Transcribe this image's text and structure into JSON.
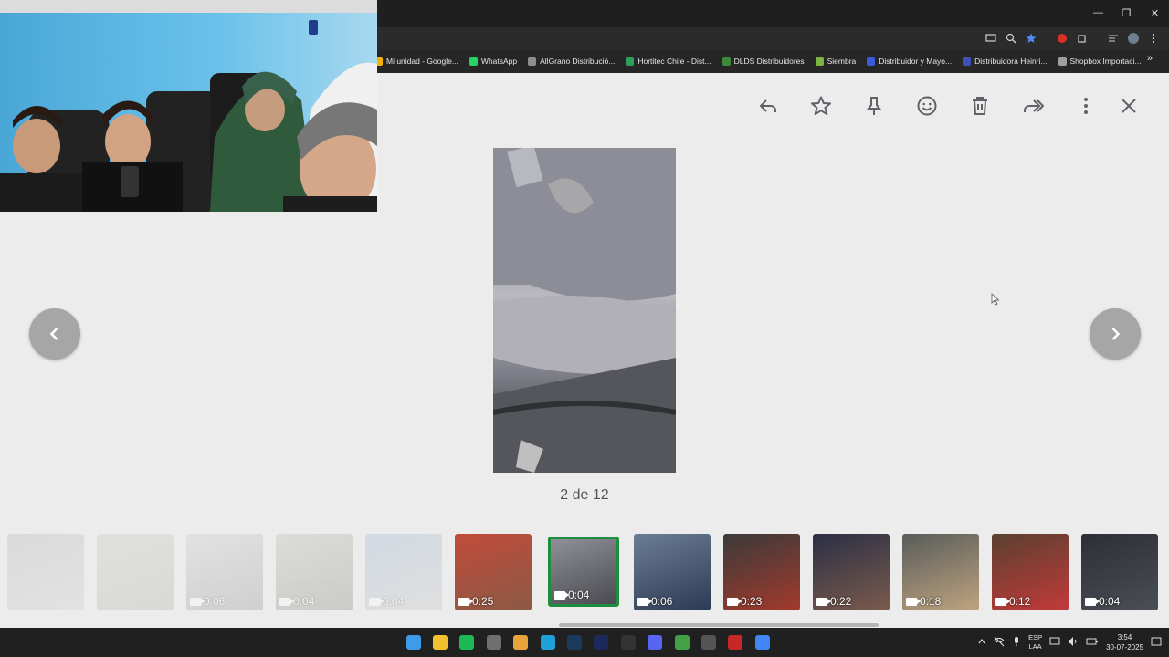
{
  "browser": {
    "window_controls": [
      "—",
      "❐",
      "✕"
    ],
    "bookmarks": [
      {
        "label": "Mi unidad - Google...",
        "icon": "google-drive-icon",
        "color": "#f4b400"
      },
      {
        "label": "WhatsApp",
        "icon": "whatsapp-icon",
        "color": "#25d366"
      },
      {
        "label": "AllGrano Distribució...",
        "icon": "allgrano-icon",
        "color": "#8d8d8d"
      },
      {
        "label": "Hortitec Chile - Dist...",
        "icon": "hortitec-icon",
        "color": "#2e9e5b"
      },
      {
        "label": "DLDS Distribuidores",
        "icon": "dlds-icon",
        "color": "#3a8a3a"
      },
      {
        "label": "Siembra",
        "icon": "siembra-icon",
        "color": "#7cb342"
      },
      {
        "label": "Distribuidor y Mayo...",
        "icon": "distribuidor-icon",
        "color": "#3b5bdb"
      },
      {
        "label": "Distribuidora Heinri...",
        "icon": "heinri-icon",
        "color": "#3f51b5"
      },
      {
        "label": "Shopbox Importaci...",
        "icon": "shopbox-icon",
        "color": "#9e9e9e"
      }
    ],
    "bookmarks_more": "»"
  },
  "viewer": {
    "toolbar": [
      "reply-icon",
      "star-icon",
      "pin-icon",
      "emoji-icon",
      "delete-icon",
      "forward-icon",
      "more-icon"
    ],
    "counter": "2 de 12",
    "accent": "#1e8e3e"
  },
  "filmstrip": [
    {
      "duration": "",
      "faded": true,
      "colors": [
        "#b8b8b8",
        "#d0d0d0"
      ]
    },
    {
      "duration": "",
      "faded": true,
      "colors": [
        "#c9c9c0",
        "#b4b4a8"
      ]
    },
    {
      "duration": "0:06",
      "faded": true,
      "colors": [
        "#cfcfcf",
        "#9a9a9a"
      ]
    },
    {
      "duration": "0:04",
      "faded": true,
      "colors": [
        "#bdbdb5",
        "#8e8e86"
      ]
    },
    {
      "duration": "0:04",
      "faded": true,
      "colors": [
        "#9fb7cf",
        "#c8c8c8"
      ]
    },
    {
      "duration": "0:25",
      "faded": false,
      "colors": [
        "#c24b3a",
        "#8a5a45"
      ]
    },
    {
      "duration": "0:04",
      "faded": false,
      "selected": true,
      "colors": [
        "#8f9098",
        "#4a4b50"
      ]
    },
    {
      "duration": "0:06",
      "faded": false,
      "colors": [
        "#6b7d93",
        "#2c3b55"
      ]
    },
    {
      "duration": "0:23",
      "faded": false,
      "colors": [
        "#3a3a3a",
        "#a33a2c"
      ]
    },
    {
      "duration": "0:22",
      "faded": false,
      "colors": [
        "#2b2f45",
        "#7a5b4c"
      ]
    },
    {
      "duration": "0:18",
      "faded": false,
      "colors": [
        "#585c5a",
        "#bfa37f"
      ]
    },
    {
      "duration": "0:12",
      "faded": false,
      "colors": [
        "#5a4030",
        "#c23a3a"
      ]
    },
    {
      "duration": "0:04",
      "faded": false,
      "colors": [
        "#2c2f35",
        "#4a4e55"
      ]
    }
  ],
  "taskbar": {
    "apps": [
      {
        "name": "windows-start-icon",
        "color": "#3d9be9"
      },
      {
        "name": "file-explorer-icon",
        "color": "#f2c230"
      },
      {
        "name": "spotify-icon",
        "color": "#1db954"
      },
      {
        "name": "calculator-icon",
        "color": "#6f6f6f"
      },
      {
        "name": "chrome-icon",
        "color": "#e8a33a"
      },
      {
        "name": "edge-icon",
        "color": "#1fa0d8"
      },
      {
        "name": "steam-icon",
        "color": "#1b3b5c"
      },
      {
        "name": "photoshop-icon",
        "color": "#1b2a5a"
      },
      {
        "name": "media-player-icon",
        "color": "#333333"
      },
      {
        "name": "discord-icon",
        "color": "#5865f2"
      },
      {
        "name": "chrome-profile-icon",
        "color": "#43a047"
      },
      {
        "name": "app-icon",
        "color": "#555555"
      },
      {
        "name": "game-icon",
        "color": "#c62828"
      },
      {
        "name": "chrome-alt-icon",
        "color": "#4285f4"
      }
    ],
    "lang_top": "ESP",
    "lang_bottom": "LAA",
    "time": "3:54",
    "date": "30-07-2025"
  }
}
